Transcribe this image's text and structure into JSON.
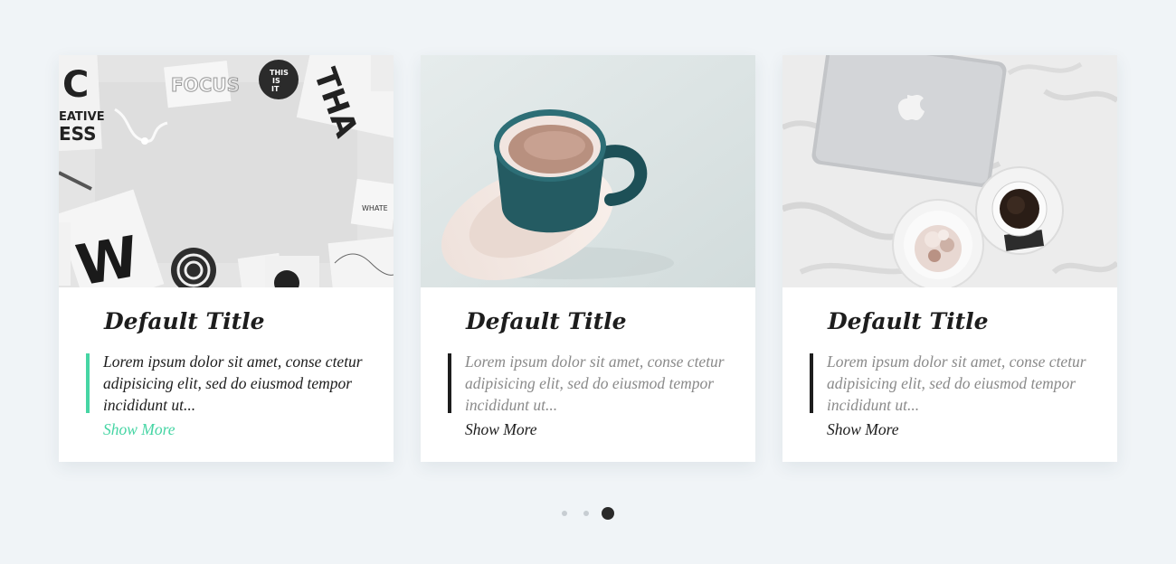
{
  "carousel": {
    "cards": [
      {
        "title": "Default Title",
        "excerpt": "Lorem ipsum dolor sit amet, conse ctetur adipisicing elit, sed do eiusmod tempor incididunt ut...",
        "link_label": "Show More",
        "accent_color": "#46d5a4",
        "highlighted": true,
        "image_icon": "desk-flatlay-image"
      },
      {
        "title": "Default Title",
        "excerpt": "Lorem ipsum dolor sit amet, conse ctetur adipisicing elit, sed do eiusmod tempor incididunt ut...",
        "link_label": "Show More",
        "accent_color": "#1d1d1d",
        "highlighted": false,
        "image_icon": "coffee-cup-image"
      },
      {
        "title": "Default Title",
        "excerpt": "Lorem ipsum dolor sit amet, conse ctetur adipisicing elit, sed do eiusmod tempor incididunt ut...",
        "link_label": "Show More",
        "accent_color": "#1d1d1d",
        "highlighted": false,
        "image_icon": "laptop-bed-image"
      }
    ],
    "pagination": {
      "page_count": 3,
      "active_page": 3
    }
  },
  "colors": {
    "page_background": "#f0f4f7",
    "accent": "#46d5a4",
    "text_dark": "#1d1d1d",
    "text_muted": "#8a8a8a",
    "dot_inactive": "#c7cdd2",
    "dot_active": "#2a2a2a"
  }
}
